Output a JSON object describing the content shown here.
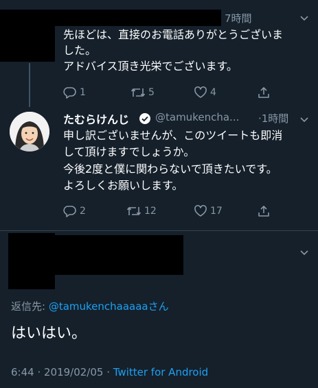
{
  "tweet1": {
    "time": "7時間",
    "lines": [
      "先ほどは、直接のお電話ありがとうございま",
      "した。",
      "アドバイス頂き光栄でございます。"
    ],
    "actions": {
      "reply": "1",
      "retweet": "5",
      "like": "4"
    }
  },
  "tweet2": {
    "display_name": "たむらけんじ",
    "handle": "@tamukencha...",
    "time": "·1時間",
    "lines": [
      "申し訳ございませんが、このツイートも即消",
      "して頂けますでしょうか。",
      "今後2度と僕に関わらないで頂きたいです。",
      "よろしくお願いします。"
    ],
    "actions": {
      "reply": "2",
      "retweet": "12",
      "like": "17"
    }
  },
  "tweet3": {
    "reply_prefix": "返信先: ",
    "reply_handle": "@tamukenchaaaaa",
    "reply_suffix": "さん",
    "body": "はいはい。",
    "timestamp": "6:44 · 2019/02/05 · ",
    "source": "Twitter for Android"
  },
  "colors": {
    "background": "#15202b",
    "muted": "#8899a6",
    "link": "#1da1f2",
    "verified": "#ffffff"
  },
  "icons": [
    "reply-icon",
    "retweet-icon",
    "like-icon",
    "share-icon",
    "chevron-down-icon",
    "verified-badge-icon"
  ]
}
